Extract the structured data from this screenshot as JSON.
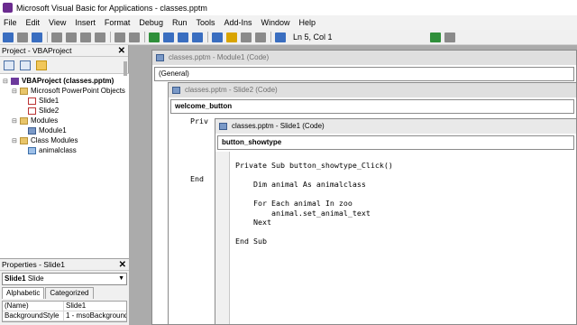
{
  "window": {
    "title": "Microsoft Visual Basic for Applications - classes.pptm"
  },
  "menu": [
    "File",
    "Edit",
    "View",
    "Insert",
    "Format",
    "Debug",
    "Run",
    "Tools",
    "Add-Ins",
    "Window",
    "Help"
  ],
  "toolbar": {
    "status": "Ln 5, Col 1"
  },
  "project": {
    "title": "Project - VBAProject",
    "tree": {
      "root": "VBAProject (classes.pptm)",
      "ppt_objects": "Microsoft PowerPoint Objects",
      "slide1": "Slide1",
      "slide2": "Slide2",
      "modules": "Modules",
      "module1": "Module1",
      "class_modules": "Class Modules",
      "animalclass": "animalclass"
    }
  },
  "properties": {
    "title": "Properties - Slide1",
    "object": "Slide1",
    "object_type": "Slide",
    "tabs": [
      "Alphabetic",
      "Categorized"
    ],
    "rows": [
      {
        "key": "(Name)",
        "value": "Slide1"
      },
      {
        "key": "BackgroundStyle",
        "value": "1 - msoBackgroundS"
      }
    ]
  },
  "windows": {
    "module1": {
      "title": "classes.pptm - Module1 (Code)",
      "combo": "(General)"
    },
    "slide2": {
      "title": "classes.pptm - Slide2 (Code)",
      "combo": "welcome_button",
      "code_fragments": [
        "Priv",
        "End"
      ]
    },
    "slide1": {
      "title": "classes.pptm - Slide1 (Code)",
      "combo": "button_showtype",
      "code": [
        "Private Sub button_showtype_Click()",
        "",
        "    Dim animal As animalclass",
        "",
        "    For Each animal In zoo",
        "        animal.set_animal_text",
        "    Next",
        "",
        "End Sub"
      ]
    }
  }
}
